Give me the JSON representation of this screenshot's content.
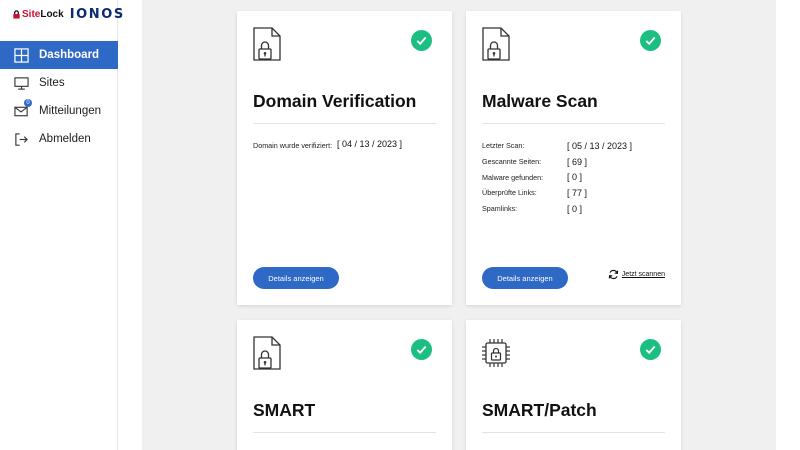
{
  "brand": {
    "sitelock_site": "Site",
    "sitelock_lock": "Lock",
    "ionos": "IONOS"
  },
  "sidebar": {
    "items": [
      {
        "label": "Dashboard",
        "icon": "grid-icon",
        "active": true
      },
      {
        "label": "Sites",
        "icon": "monitor-icon"
      },
      {
        "label": "Mitteilungen",
        "icon": "mail-icon",
        "badge": "0"
      },
      {
        "label": "Abmelden",
        "icon": "logout-icon"
      }
    ]
  },
  "cards": {
    "domain": {
      "title": "Domain Verification",
      "label": "Domain wurde verifiziert:",
      "value": "[ 04 / 13 / 2023 ]",
      "button": "Details anzeigen"
    },
    "malware": {
      "title": "Malware Scan",
      "rows": [
        {
          "label": "Letzter Scan:",
          "value": "[ 05 / 13 / 2023 ]"
        },
        {
          "label": "Gescannte Seiten:",
          "value": "[ 69 ]"
        },
        {
          "label": "Malware gefunden:",
          "value": "[ 0 ]"
        },
        {
          "label": "Überprüfte Links:",
          "value": "[ 77 ]"
        },
        {
          "label": "Spamlinks:",
          "value": "[ 0 ]"
        }
      ],
      "button": "Details anzeigen",
      "rescan": "Jetzt scannen"
    },
    "smart": {
      "title": "SMART"
    },
    "smart_patch": {
      "title": "SMART/Patch"
    }
  },
  "colors": {
    "accent": "#2f69c6",
    "success": "#1bbf82",
    "background": "#f0f0f0"
  }
}
